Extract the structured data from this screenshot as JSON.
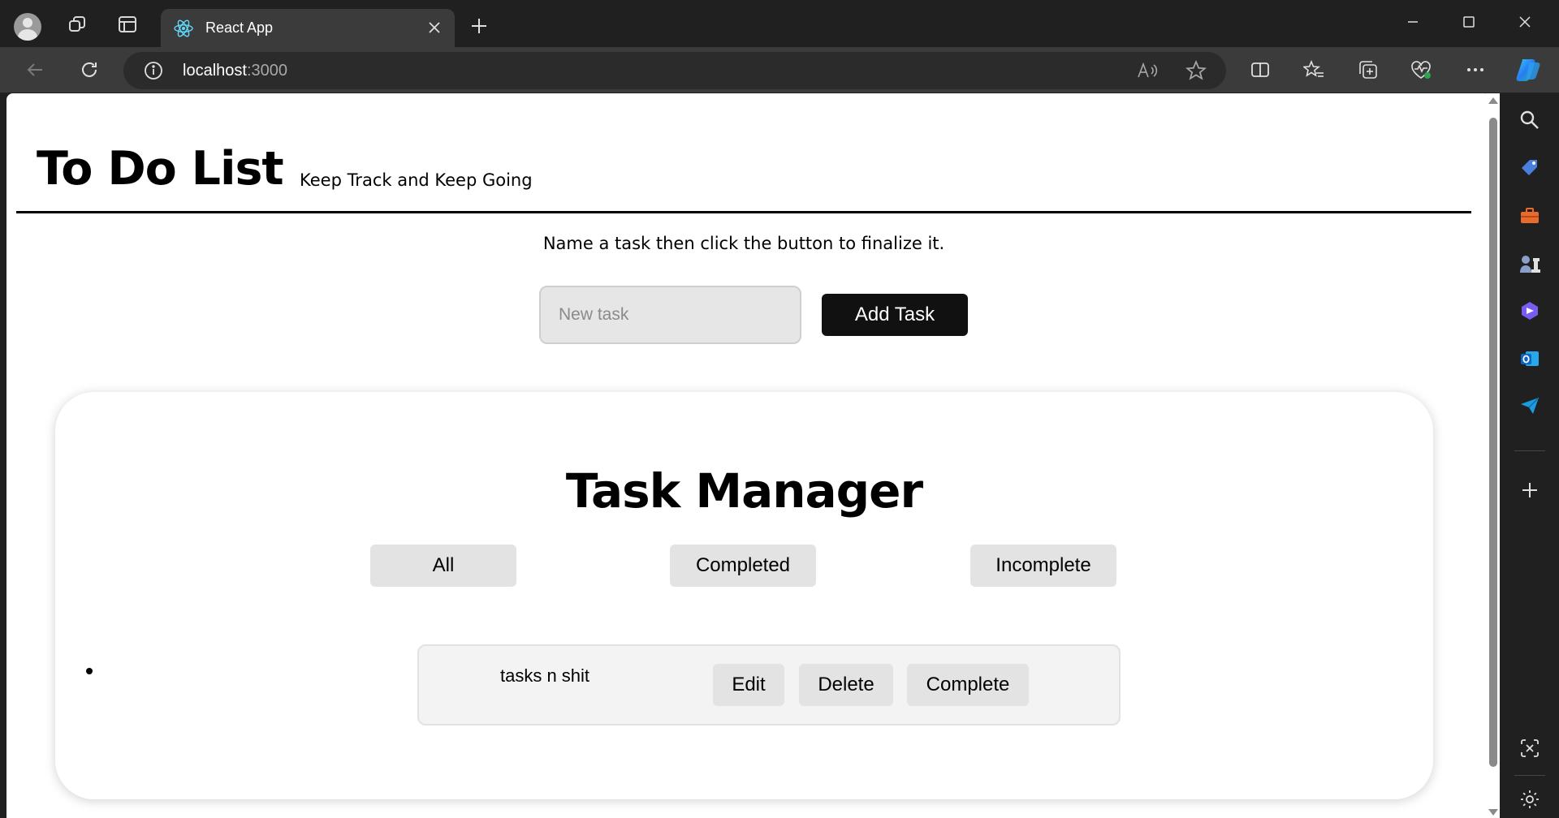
{
  "browser": {
    "tab": {
      "title": "React App"
    },
    "address": {
      "host": "localhost",
      "port": ":3000"
    }
  },
  "page": {
    "title": "To Do List",
    "subtitle": "Keep Track and Keep Going",
    "instructions": "Name a task then click the button to finalize it.",
    "new_task": {
      "placeholder": "New task",
      "value": ""
    },
    "add_button_label": "Add Task"
  },
  "task_manager": {
    "title": "Task Manager",
    "filters": [
      {
        "label": "All"
      },
      {
        "label": "Completed"
      },
      {
        "label": "Incomplete"
      }
    ],
    "tasks": [
      {
        "text": "tasks n shit",
        "actions": {
          "edit": "Edit",
          "delete": "Delete",
          "complete": "Complete"
        }
      }
    ]
  },
  "icons": {
    "profile": "avatar-icon",
    "workspaces": "workspaces-icon",
    "tab_actions": "tab-actions-icon",
    "favicon": "react-logo-icon",
    "back": "back-arrow-icon",
    "refresh": "refresh-icon",
    "site_info": "info-icon",
    "read_aloud": "read-aloud-icon",
    "favorite": "star-icon",
    "split_screen": "split-screen-icon",
    "favorites": "favorites-icon",
    "collections": "collections-icon",
    "health": "browser-essentials-icon",
    "more": "more-icon",
    "copilot": "copilot-icon"
  },
  "colors": {
    "accent": "#111111",
    "button_gray": "#e3e3e3",
    "browser_dark": "#202020"
  }
}
